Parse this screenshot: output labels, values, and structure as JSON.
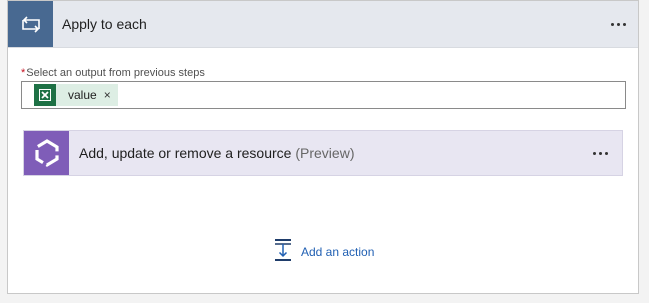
{
  "loop_card": {
    "title": "Apply to each",
    "header_color": "#e5e8ee",
    "icon_bg": "#486991",
    "more_icon": "ellipsis-icon"
  },
  "output_field": {
    "required_mark": "*",
    "label": "Select an output from previous steps",
    "token": {
      "icon": "excel-icon",
      "icon_color": "#1e7145",
      "text": "value",
      "remove": "×"
    }
  },
  "nested_action": {
    "title": "Add, update or remove a resource",
    "badge": "(Preview)",
    "icon": "resource-connector-icon",
    "icon_bg": "#7f5db8",
    "bg": "#e8e6f2",
    "more_icon": "ellipsis-icon"
  },
  "add_action": {
    "label": "Add an action",
    "icon": "add-action-icon",
    "color": "#2160b3"
  }
}
